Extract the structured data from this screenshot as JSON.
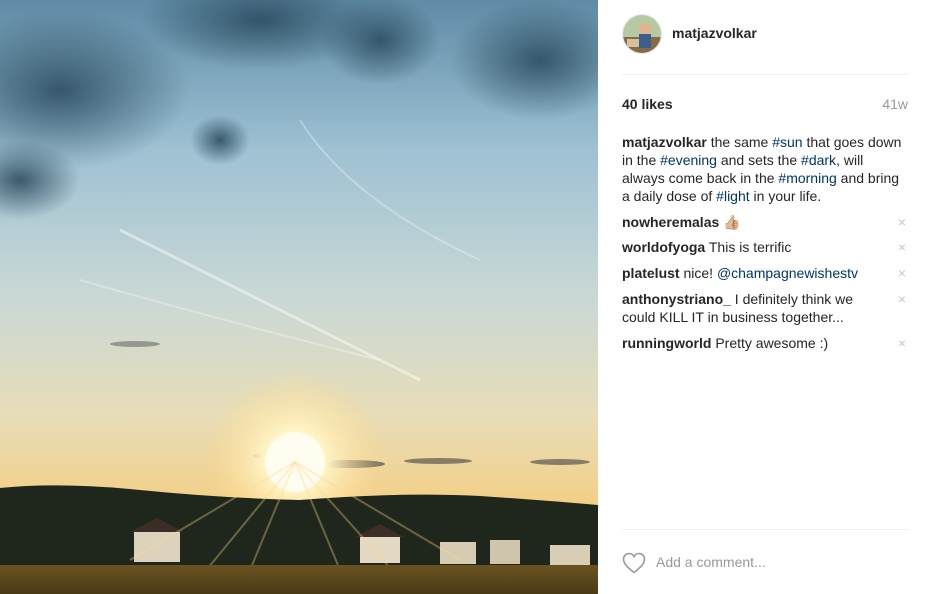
{
  "post": {
    "username": "matjazvolkar",
    "likes": "40 likes",
    "time_ago": "41w",
    "caption": {
      "username": "matjazvolkar",
      "segments": [
        {
          "text": " the same ",
          "type": "text"
        },
        {
          "text": "#sun",
          "type": "tag"
        },
        {
          "text": " that goes down in the ",
          "type": "text"
        },
        {
          "text": "#evening",
          "type": "tag"
        },
        {
          "text": " and sets the ",
          "type": "text"
        },
        {
          "text": "#dark",
          "type": "tag"
        },
        {
          "text": ", will always come back in the ",
          "type": "text"
        },
        {
          "text": "#morning",
          "type": "tag"
        },
        {
          "text": " and bring a daily dose of ",
          "type": "text"
        },
        {
          "text": "#light",
          "type": "tag"
        },
        {
          "text": " in your life.",
          "type": "text"
        }
      ]
    }
  },
  "comments": [
    {
      "username": "nowheremalas",
      "text": " 👍🏼",
      "mention": ""
    },
    {
      "username": "worldofyoga",
      "text": " This is terrific",
      "mention": ""
    },
    {
      "username": "platelust",
      "text": " nice! ",
      "mention": "@champagnewishestv"
    },
    {
      "username": "anthonystriano_",
      "text": " I definitely think we could KILL IT in business together...",
      "mention": ""
    },
    {
      "username": "runningworld",
      "text": " Pretty awesome :)",
      "mention": ""
    }
  ],
  "delete_glyph": "×",
  "footer": {
    "like_icon": "heart-outline-icon",
    "comment_placeholder": "Add a comment..."
  },
  "colors": {
    "hashtag": "#003569",
    "muted": "#999999",
    "text": "#262626"
  }
}
